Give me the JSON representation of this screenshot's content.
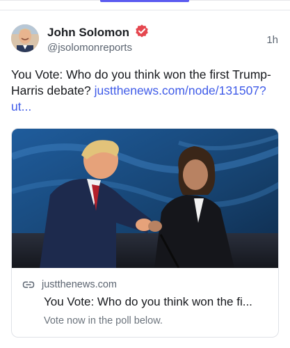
{
  "post": {
    "author": {
      "display_name": "John Solomon",
      "handle": "@jsolomonreports",
      "verified": true,
      "avatar_icon": "user-avatar-photo"
    },
    "timestamp": "1h",
    "text": "You Vote: Who do you think won the first Trump-Harris debate? ",
    "link_text": "justthenews.com/node/131507?ut...",
    "embed": {
      "image_icon": "debate-handshake-photo",
      "link_icon": "link-icon",
      "domain": "justthenews.com",
      "title": "You Vote: Who do you think won the fi...",
      "description": "Vote now in the poll below."
    }
  },
  "colors": {
    "accent": "#5b5bf0",
    "link": "#3f5be8",
    "verified_badge": "#e5474f",
    "muted_text": "#5b6470",
    "card_border": "#dfe2e7"
  }
}
